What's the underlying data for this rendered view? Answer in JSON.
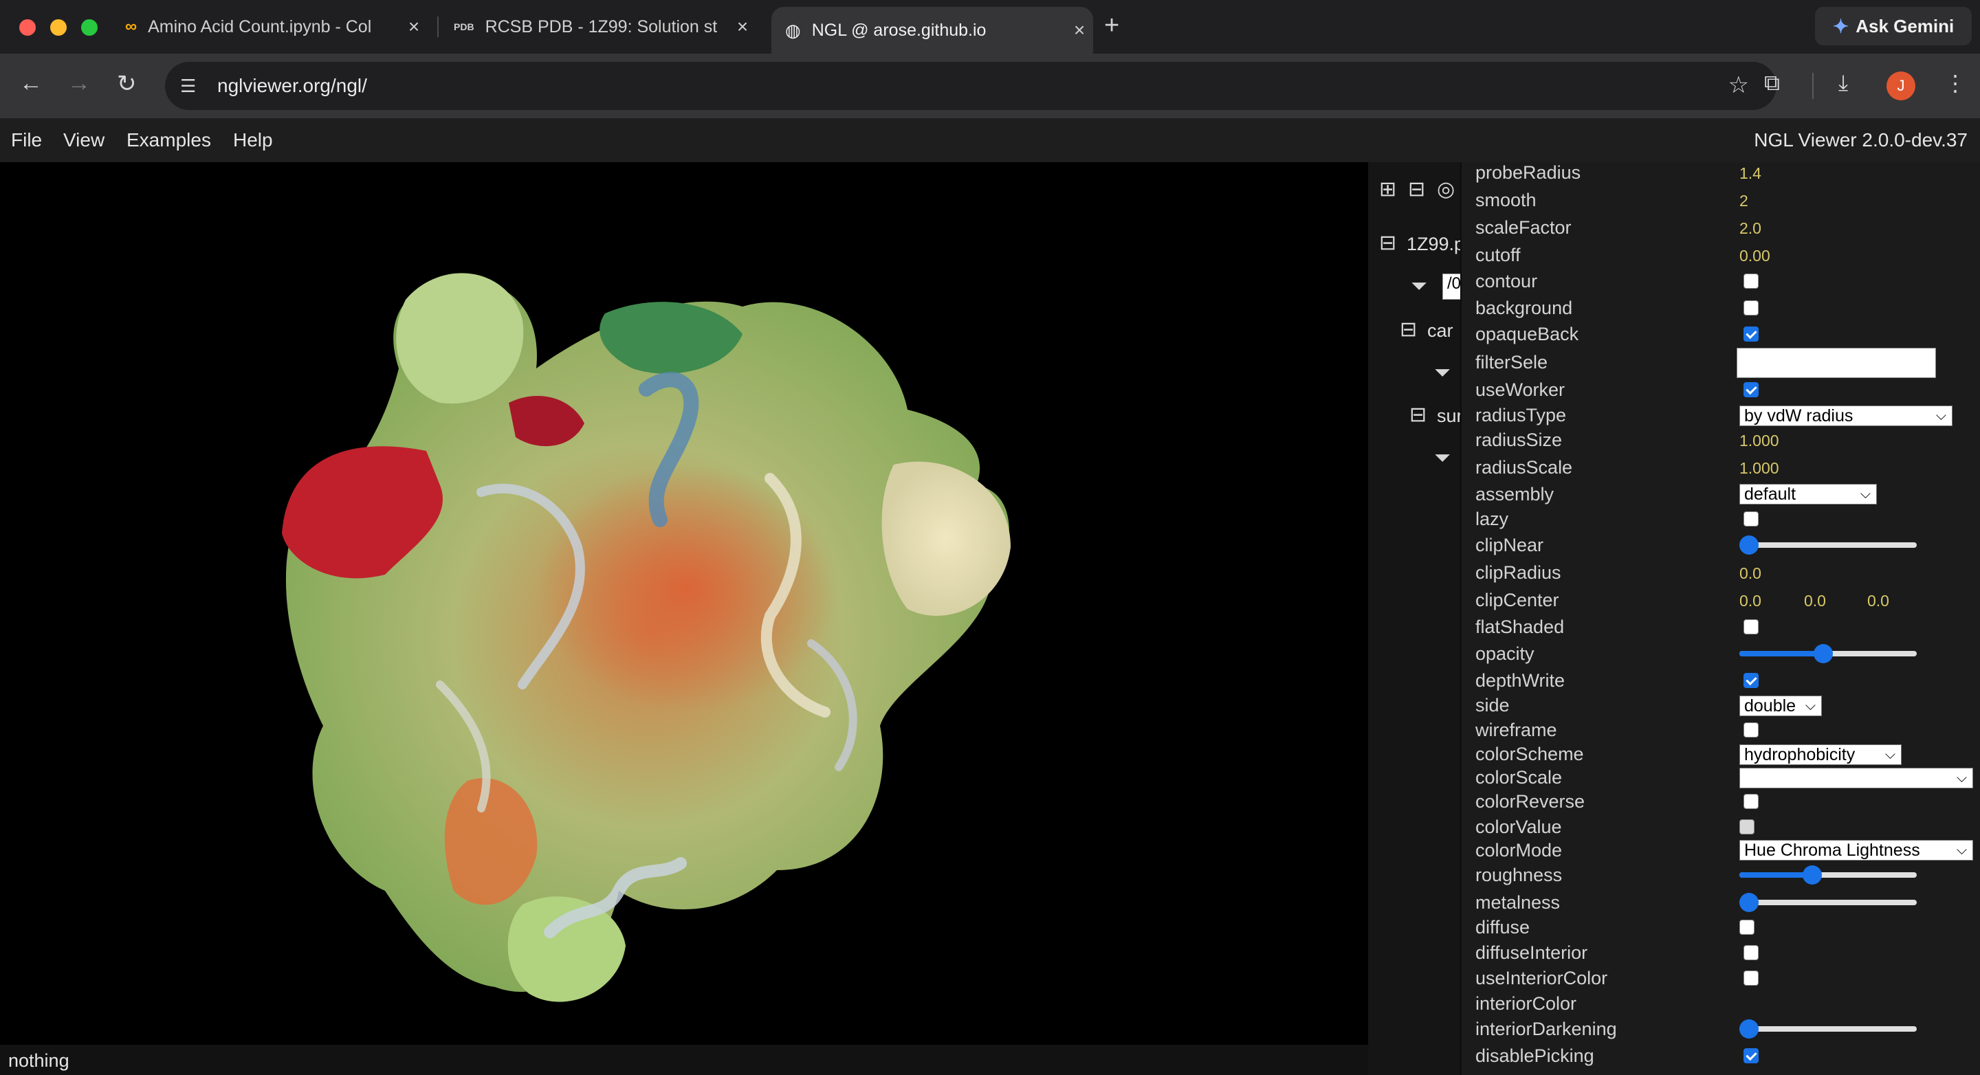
{
  "browser": {
    "tabs": [
      {
        "title": "Amino Acid Count.ipynb - Col",
        "icon": "colab-icon",
        "active": false
      },
      {
        "title": "RCSB PDB - 1Z99: Solution st",
        "icon": "pdb-icon",
        "active": false
      },
      {
        "title": "NGL @ arose.github.io",
        "icon": "globe-icon",
        "active": true
      }
    ],
    "ask_gemini": "Ask Gemini",
    "url": "nglviewer.org/ngl/"
  },
  "app": {
    "menu": [
      "File",
      "View",
      "Examples",
      "Help"
    ],
    "title": "NGL Viewer 2.0.0-dev.37",
    "status": "nothing"
  },
  "sidebar": {
    "structure_label": "1Z99.p",
    "filter_value": "/0",
    "rep1_label": "car",
    "rep2_label": "sur"
  },
  "props": {
    "probeRadius": {
      "label": "probeRadius",
      "value": "1.4"
    },
    "smooth": {
      "label": "smooth",
      "value": "2"
    },
    "scaleFactor": {
      "label": "scaleFactor",
      "value": "2.0"
    },
    "cutoff": {
      "label": "cutoff",
      "value": "0.00"
    },
    "contour": {
      "label": "contour",
      "checked": false
    },
    "background": {
      "label": "background",
      "checked": false
    },
    "opaqueBack": {
      "label": "opaqueBack",
      "checked": true
    },
    "filterSele": {
      "label": "filterSele",
      "value": ""
    },
    "useWorker": {
      "label": "useWorker",
      "checked": true
    },
    "radiusType": {
      "label": "radiusType",
      "value": "by vdW radius"
    },
    "radiusSize": {
      "label": "radiusSize",
      "value": "1.000"
    },
    "radiusScale": {
      "label": "radiusScale",
      "value": "1.000"
    },
    "assembly": {
      "label": "assembly",
      "value": "default"
    },
    "lazy": {
      "label": "lazy",
      "checked": false
    },
    "clipNear": {
      "label": "clipNear",
      "level": 0.0
    },
    "clipRadius": {
      "label": "clipRadius",
      "value": "0.0"
    },
    "clipCenter": {
      "label": "clipCenter",
      "x": "0.0",
      "y": "0.0",
      "z": "0.0"
    },
    "flatShaded": {
      "label": "flatShaded",
      "checked": false
    },
    "opacity": {
      "label": "opacity",
      "level": 0.47
    },
    "depthWrite": {
      "label": "depthWrite",
      "checked": true
    },
    "side": {
      "label": "side",
      "value": "double"
    },
    "wireframe": {
      "label": "wireframe",
      "checked": false
    },
    "colorScheme": {
      "label": "colorScheme",
      "value": "hydrophobicity"
    },
    "colorScale": {
      "label": "colorScale",
      "value": ""
    },
    "colorReverse": {
      "label": "colorReverse",
      "checked": false
    },
    "colorValue": {
      "label": "colorValue",
      "color": "#d9d9d9"
    },
    "colorMode": {
      "label": "colorMode",
      "value": "Hue Chroma Lightness"
    },
    "roughness": {
      "label": "roughness",
      "level": 0.4
    },
    "metalness": {
      "label": "metalness",
      "level": 0.0
    },
    "diffuse": {
      "label": "diffuse",
      "checked": false
    },
    "diffuseInterior": {
      "label": "diffuseInterior",
      "checked": false
    },
    "useInteriorColor": {
      "label": "useInteriorColor",
      "checked": false
    },
    "interiorColor": {
      "label": "interiorColor"
    },
    "interiorDarkening": {
      "label": "interiorDarkening",
      "level": 0.0
    },
    "disablePicking": {
      "label": "disablePicking",
      "checked": true
    }
  }
}
